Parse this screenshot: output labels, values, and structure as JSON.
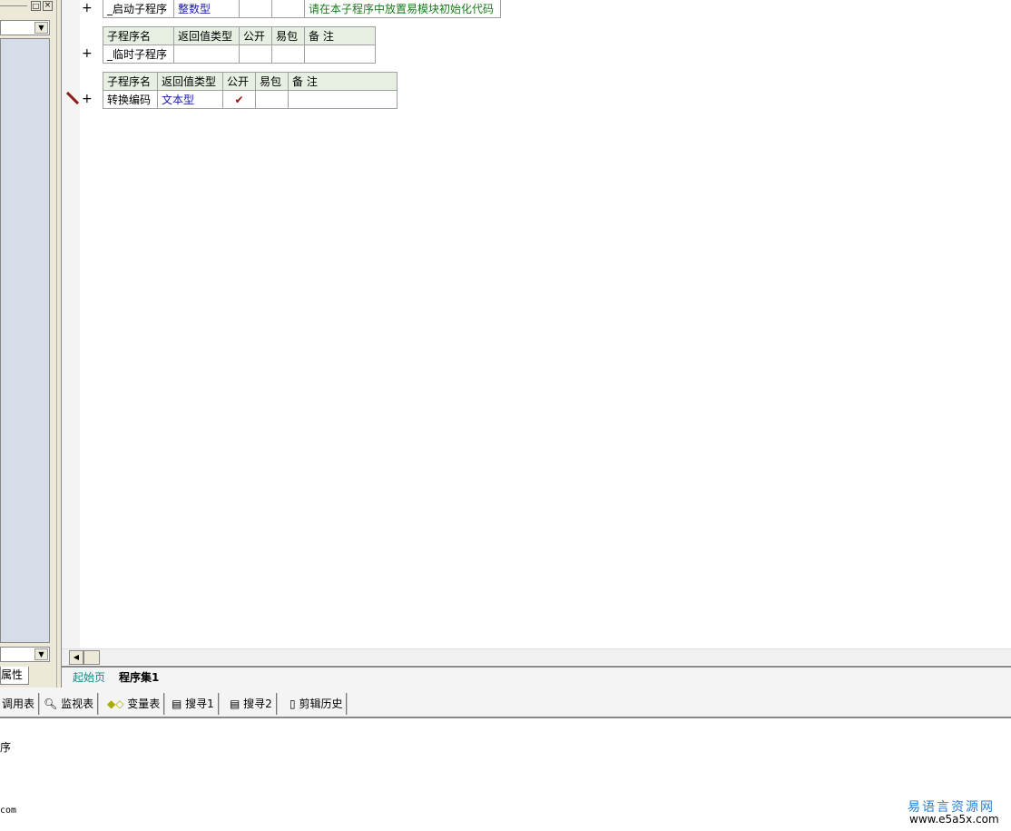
{
  "left_panel": {
    "tab_label": "属性"
  },
  "tables": [
    {
      "header": null,
      "rows": [
        [
          "_启动子程序",
          "整数型",
          "",
          "",
          "请在本子程序中放置易模块初始化代码"
        ]
      ]
    },
    {
      "header": [
        "子程序名",
        "返回值类型",
        "公开",
        "易包",
        "备 注"
      ],
      "rows": [
        [
          "_临时子程序",
          "",
          "",
          "",
          ""
        ]
      ]
    },
    {
      "header": [
        "子程序名",
        "返回值类型",
        "公开",
        "易包",
        "备 注"
      ],
      "rows": [
        [
          "转换编码",
          "文本型",
          "✔",
          "",
          ""
        ]
      ]
    }
  ],
  "tabs": [
    {
      "label": "起始页",
      "active": false
    },
    {
      "label": "程序集1",
      "active": true
    }
  ],
  "bottom_toolbar": [
    {
      "label": "调用表",
      "icon": "call-table-icon"
    },
    {
      "label": "监视表",
      "icon": "magnifier-icon"
    },
    {
      "label": "变量表",
      "icon": "variable-icon"
    },
    {
      "label": "搜寻1",
      "icon": "search-doc-icon"
    },
    {
      "label": "搜寻2",
      "icon": "search-doc-icon"
    },
    {
      "label": "剪辑历史",
      "icon": "clipboard-icon"
    }
  ],
  "output": {
    "line1": "序",
    "line2": "com"
  },
  "watermark": {
    "title": "易语言资源网",
    "url": "www.e5a5x.com"
  }
}
